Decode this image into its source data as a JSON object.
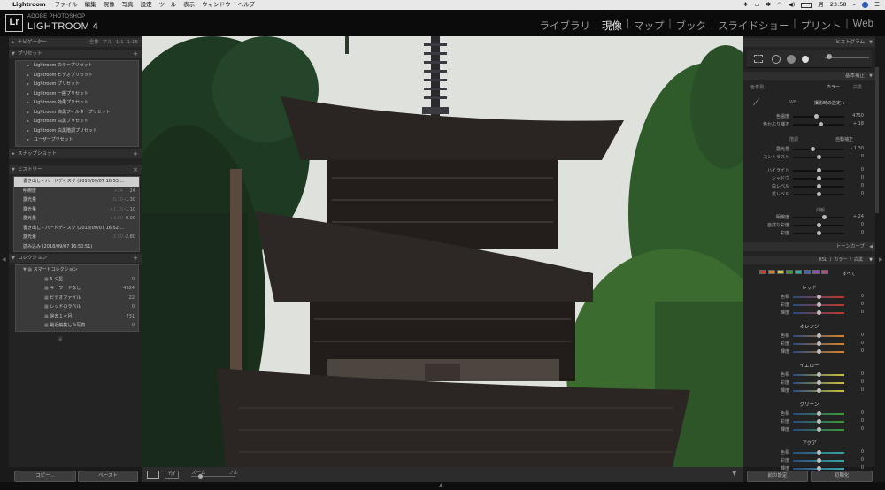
{
  "menubar": {
    "app": "Lightroom",
    "items": [
      "ファイル",
      "編集",
      "現像",
      "写真",
      "設定",
      "ツール",
      "表示",
      "ウィンドウ",
      "ヘルプ"
    ],
    "status": {
      "day": "月",
      "time": "23:58"
    }
  },
  "identity": {
    "logo": "Lr",
    "brand_small": "ADOBE PHOTOSHOP",
    "brand_large": "LIGHTROOM 4"
  },
  "modules": [
    {
      "label": "ライブラリ",
      "active": false
    },
    {
      "label": "現像",
      "active": true
    },
    {
      "label": "マップ",
      "active": false
    },
    {
      "label": "ブック",
      "active": false
    },
    {
      "label": "スライドショー",
      "active": false
    },
    {
      "label": "プリント",
      "active": false
    },
    {
      "label": "Web",
      "active": false
    }
  ],
  "left": {
    "navigator": {
      "title": "ナビゲーター",
      "zoom_options": [
        "全体",
        "フル",
        "1:1",
        "1:16"
      ]
    },
    "presets": {
      "title": "プリセット",
      "items": [
        "Lightroom カラープリセット",
        "Lightroom ビデオプリセット",
        "Lightroom プリセット",
        "Lightroom 一般プリセット",
        "Lightroom 効果プリセット",
        "Lightroom 白黒フィルタープリセット",
        "Lightroom 白黒プリセット",
        "Lightroom 白黒階調プリセット",
        "ユーザープリセット"
      ]
    },
    "snapshot": {
      "title": "スナップショット"
    },
    "history": {
      "title": "ヒストリー",
      "rows": [
        {
          "label": "書き出し - ハードディスク (2018/09/07 16:53:...",
          "v1": "",
          "v2": "",
          "selected": true
        },
        {
          "label": "明瞭度",
          "v1": "+24",
          "v2": "24",
          "selected": false
        },
        {
          "label": "露光量",
          "v1": "-0.20",
          "v2": "-1.30",
          "selected": false
        },
        {
          "label": "露光量",
          "v1": "+1.10",
          "v2": "-1.10",
          "selected": false
        },
        {
          "label": "露光量",
          "v1": "+2.80",
          "v2": "0.00",
          "selected": false
        },
        {
          "label": "書き出し - ハードディスク (2018/09/07 16:52:...",
          "v1": "",
          "v2": "",
          "selected": false
        },
        {
          "label": "露光量",
          "v1": "-2.80",
          "v2": "-2.80",
          "selected": false
        },
        {
          "label": "読み込み (2018/09/07 16:50:51)",
          "v1": "",
          "v2": "",
          "selected": false
        }
      ]
    },
    "collections": {
      "title": "コレクション",
      "group": "スマートコレクション",
      "items": [
        {
          "label": "5 つ星",
          "count": "0"
        },
        {
          "label": "キーワードなし",
          "count": "4824"
        },
        {
          "label": "ビデオファイル",
          "count": "22"
        },
        {
          "label": "レッドのラベル",
          "count": "0"
        },
        {
          "label": "過去１ヶ月",
          "count": "731"
        },
        {
          "label": "最近編集した写真",
          "count": "0"
        }
      ]
    },
    "buttons": {
      "copy": "コピー...",
      "paste": "ペースト"
    }
  },
  "toolbar": {
    "zoom_label": "ズーム",
    "zoom_value": "フル"
  },
  "right": {
    "histogram_title": "ヒストグラム",
    "basic_title": "基本補正",
    "treatment_label": "色表現 :",
    "treatment_color": "カラー",
    "treatment_bw": "白黒",
    "wb_label": "WB :",
    "wb_value": "撮影時の設定 ÷",
    "wb_sliders": [
      {
        "label": "色温度",
        "value": "4750",
        "pos": 0.45
      },
      {
        "label": "色かぶり補正",
        "value": "+ 18",
        "pos": 0.55
      }
    ],
    "tone_label": "階調",
    "auto_label": "自動補正",
    "tone_sliders": [
      {
        "label": "露光量",
        "value": "- 1.30",
        "pos": 0.38
      },
      {
        "label": "コントラスト",
        "value": "0",
        "pos": 0.5
      }
    ],
    "tone2_sliders": [
      {
        "label": "ハイライト",
        "value": "0",
        "pos": 0.5
      },
      {
        "label": "シャドウ",
        "value": "0",
        "pos": 0.5
      },
      {
        "label": "白レベル",
        "value": "0",
        "pos": 0.5
      },
      {
        "label": "黒レベル",
        "value": "0",
        "pos": 0.5
      }
    ],
    "presence_label": "外観",
    "presence_sliders": [
      {
        "label": "明瞭度",
        "value": "+ 24",
        "pos": 0.62
      },
      {
        "label": "自然な彩度",
        "value": "0",
        "pos": 0.5
      },
      {
        "label": "彩度",
        "value": "0",
        "pos": 0.5
      }
    ],
    "tonecurve_title": "トーンカーブ",
    "hsl_tabs": [
      "HSL",
      "/",
      "カラー",
      "/",
      "白黒"
    ],
    "hsl_all": "すべて",
    "hsl_groups": [
      {
        "name": "レッド",
        "color": "#c0392b"
      },
      {
        "name": "オレンジ",
        "color": "#d9822b"
      },
      {
        "name": "イエロー",
        "color": "#cfc23a"
      },
      {
        "name": "グリーン",
        "color": "#3a9a3a"
      },
      {
        "name": "アクア",
        "color": "#3aa6a6"
      }
    ],
    "hsl_rows": [
      "色相",
      "彩度",
      "輝度"
    ],
    "hsl_value": "0",
    "buttons": {
      "previous": "前の設定",
      "reset": "初期化"
    }
  }
}
